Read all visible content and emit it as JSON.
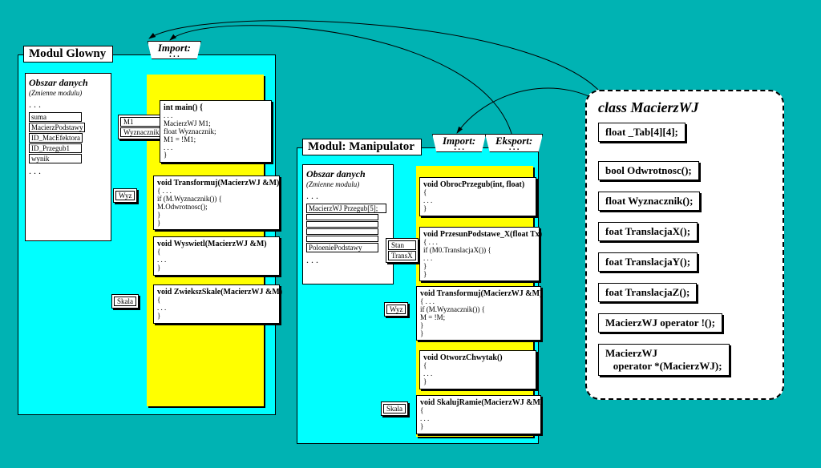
{
  "module_main": {
    "title": "Modul Glowny",
    "import_label": "Import:",
    "data_area": {
      "heading": "Obszar danych",
      "subheading": "(Zmienne modulu)",
      "dots": ". . .",
      "vars": [
        "suma",
        "MacierzPodstawy",
        "ID_MacEfektora",
        "ID_Przegub1",
        "wynik"
      ],
      "trailing_dots": ". . ."
    },
    "func_main": {
      "pill1": "M1",
      "pill2": "Wyznacznik",
      "signature": "int main() {",
      "body_lines": [
        ". . .",
        "MacierzWJ  M1;",
        "float  Wyznacznik;",
        "M1 = !M1;",
        ". . .",
        "}"
      ]
    },
    "func_transform": {
      "pill": "Wyz",
      "signature": "void Transformuj(MacierzWJ &M)",
      "body_lines": [
        "{ . . .",
        "  if (M.Wyznacznik()) {",
        "    M.Odwrotnosc();",
        "  }",
        "}"
      ]
    },
    "func_wyswietl": {
      "signature": "void Wyswietl(MacierzWJ &M)",
      "body_lines": [
        "{",
        ". . .",
        "}"
      ]
    },
    "func_zwieksz": {
      "pill": "Skala",
      "signature": "void ZwiekszSkale(MacierzWJ &M)",
      "body_lines": [
        "{",
        ". . .",
        "}"
      ]
    }
  },
  "module_manip": {
    "title": "Modul: Manipulator",
    "import_label": "Import:",
    "export_label": "Eksport:",
    "data_area": {
      "heading": "Obszar danych",
      "subheading": "(Zmienne modulu)",
      "dots": ". . .",
      "arr_label": "MacierzWJ Przegub[5];",
      "polozenie": "PoloeniePodstawy",
      "trailing_dots": ". . ."
    },
    "func_obroc": {
      "signature": "void ObrocPrzegub(int, float)",
      "body_lines": [
        "{",
        ". . .",
        "}"
      ]
    },
    "func_przesun": {
      "pill1": "Stan",
      "pill2": "TransX",
      "signature": "void PrzesunPodstawe_X(float Tx)",
      "body_lines": [
        "{ . . .",
        "  if (M0.TranslacjaX()) {",
        "   . . .",
        "  }",
        "}"
      ]
    },
    "func_transform": {
      "pill": "Wyz",
      "signature": "void Transformuj(MacierzWJ &M)",
      "body_lines": [
        "{ . . .",
        "  if (M.Wyznacznik()) {",
        "    M = !M;",
        "  }",
        "}"
      ]
    },
    "func_otworz": {
      "signature": "void OtworzChwytak()",
      "body_lines": [
        "{",
        ". . .",
        "}"
      ]
    },
    "func_skaluj": {
      "pill": "Skala",
      "signature": "void SkalujRamie(MacierzWJ &M)",
      "body_lines": [
        "{",
        ". . .",
        "}"
      ]
    }
  },
  "class_box": {
    "title": "class MacierzWJ",
    "members": [
      "float _Tab[4][4];",
      "bool Odwrotnosc();",
      "float Wyznacznik();",
      "foat TranslacjaX();",
      "foat TranslacjaY();",
      "foat TranslacjaZ();",
      "MacierzWJ operator !();",
      "MacierzWJ\n   operator *(MacierzWJ);"
    ]
  }
}
